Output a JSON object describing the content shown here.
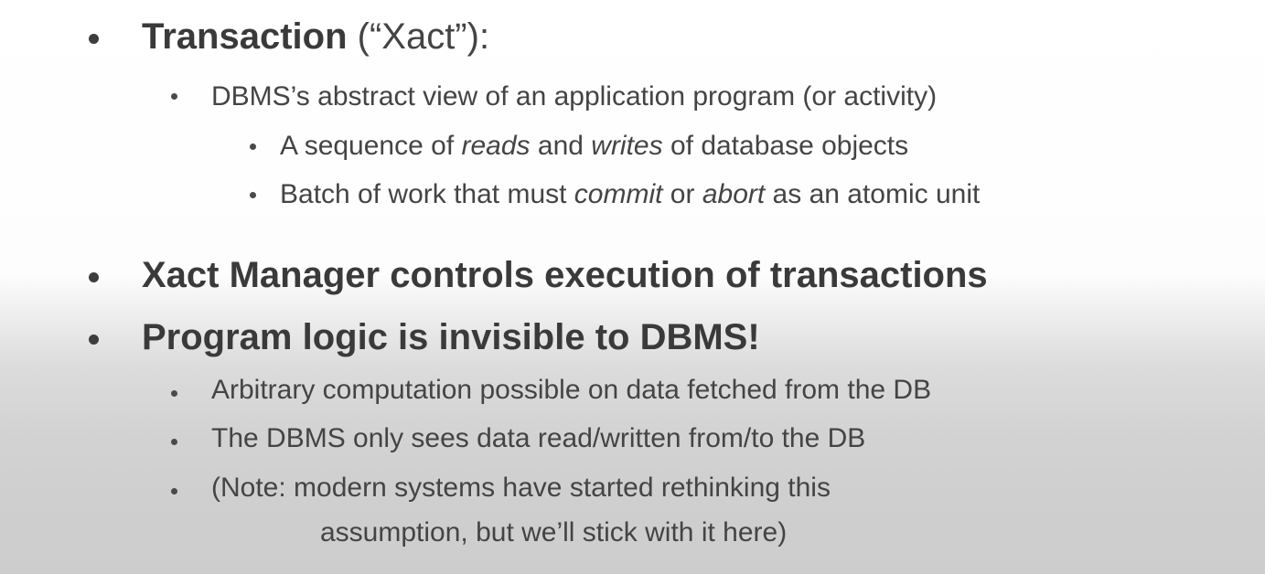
{
  "slide": {
    "b1": {
      "bold": "Transaction",
      "rest": " (“Xact”):"
    },
    "b1_sub1": "DBMS’s abstract view of an application program (or activity)",
    "b1_sub1_a": {
      "pre": "A sequence of ",
      "em1": "reads",
      "mid": " and ",
      "em2": "writes",
      "post": " of database objects"
    },
    "b1_sub1_b": {
      "pre": "Batch of work that must ",
      "em1": "commit",
      "mid": " or ",
      "em2": "abort",
      "post": " as an atomic unit"
    },
    "b2": "Xact Manager controls execution of transactions",
    "b3": "Program logic is invisible to DBMS!",
    "b3_sub1": "Arbitrary computation possible on data fetched from the DB",
    "b3_sub2": "The DBMS only sees data read/written from/to the DB",
    "b3_sub3_line1": "(Note: modern systems have started rethinking this",
    "b3_sub3_line2": "assumption, but we’ll stick with it here)"
  }
}
